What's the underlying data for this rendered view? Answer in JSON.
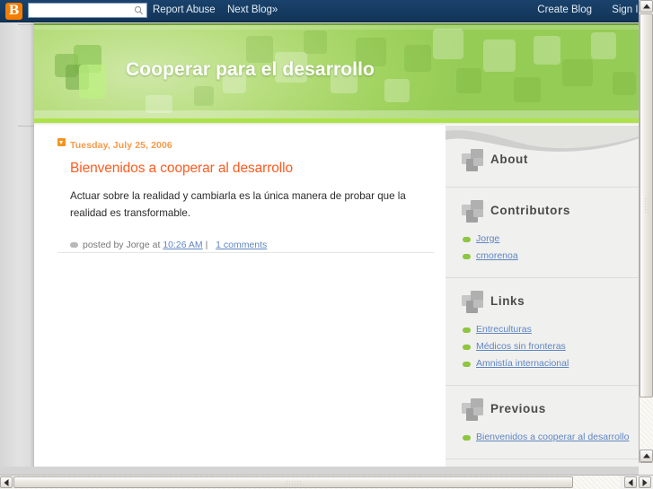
{
  "navbar": {
    "logo_letter": "B",
    "search_placeholder": "",
    "search_value": "",
    "report_abuse": "Report Abuse",
    "next_blog": "Next Blog»",
    "create_blog": "Create Blog",
    "sign_in": "Sign In"
  },
  "header": {
    "title": "Cooperar para el desarrollo"
  },
  "post": {
    "date": "Tuesday, July 25, 2006",
    "title": "Bienvenidos a cooperar al desarrollo",
    "body": "Actuar sobre la realidad y cambiarla es la única manera de probar que la realidad es transformable.",
    "footer_prefix": "posted by Jorge at",
    "time": "10:26 AM",
    "separator": "|",
    "comments": "1 comments"
  },
  "sidebar": {
    "sections": [
      {
        "title": "About",
        "items": []
      },
      {
        "title": "Contributors",
        "items": [
          "Jorge",
          "cmorenoa"
        ]
      },
      {
        "title": "Links",
        "items": [
          "Entreculturas",
          "Médicos sin fronteras",
          "Amnistía internacional"
        ]
      },
      {
        "title": "Previous",
        "items": [
          "Bienvenidos a cooperar al desarrollo"
        ]
      }
    ]
  },
  "colors": {
    "navbar_bg": "#13385f",
    "logo_orange": "#f57d00",
    "header_green": "#9fd25e",
    "accent_bar_green": "#aee249",
    "post_title_orange": "#ff5b1f",
    "post_date_orange": "#f79a4a",
    "link_blue": "#5f86c2",
    "bullet_green": "#8dc63f",
    "sidebar_bg": "#f0f0ef"
  },
  "icons": {
    "search": "search-icon",
    "date_marker": "date-expand-icon",
    "comment": "comment-bubble-icon",
    "section": "squares-icon",
    "bullet": "bullet-icon"
  }
}
